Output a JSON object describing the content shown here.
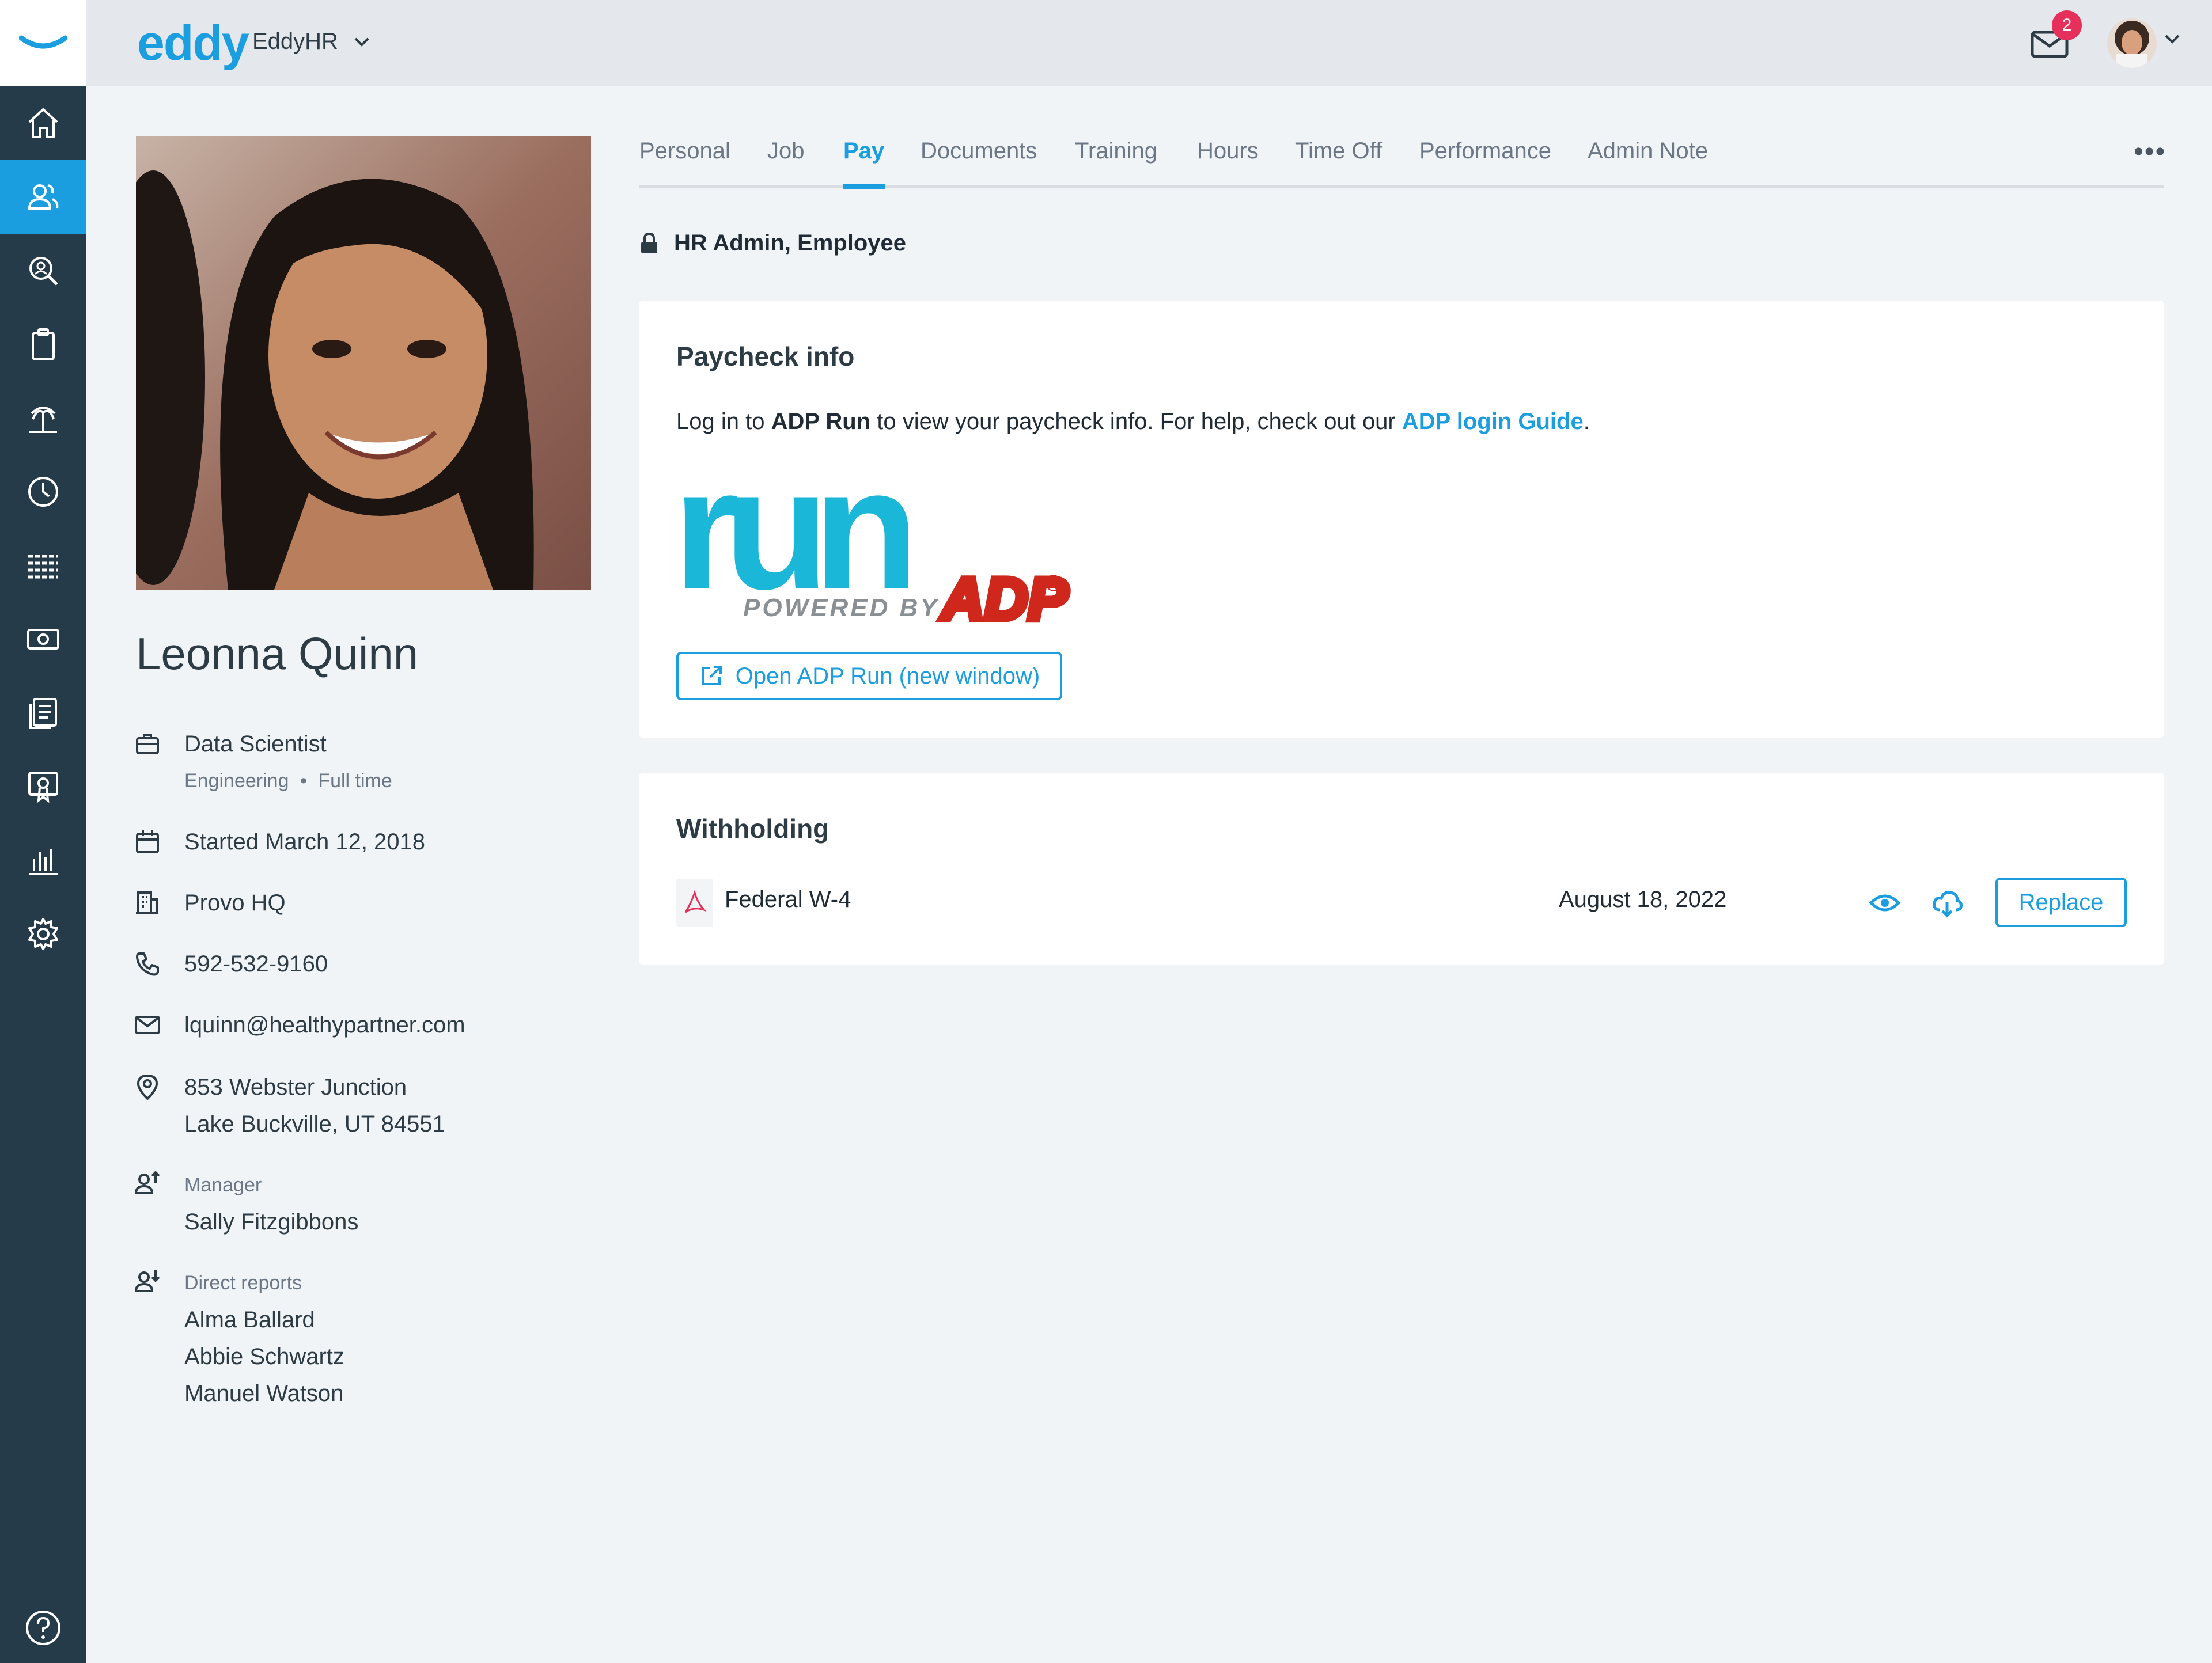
{
  "header": {
    "brand": "eddy",
    "company": "EddyHR",
    "notification_count": "2"
  },
  "sidebar": {
    "items": [
      {
        "icon": "home-icon"
      },
      {
        "icon": "people-icon",
        "active": true
      },
      {
        "icon": "search-person-icon"
      },
      {
        "icon": "clipboard-icon"
      },
      {
        "icon": "palm-tree-icon"
      },
      {
        "icon": "clock-icon"
      },
      {
        "icon": "table-grid-icon"
      },
      {
        "icon": "money-icon"
      },
      {
        "icon": "documents-icon"
      },
      {
        "icon": "certificate-icon"
      },
      {
        "icon": "bar-chart-icon"
      },
      {
        "icon": "gear-icon"
      }
    ],
    "help_icon": "help-icon"
  },
  "profile": {
    "name": "Leonna Quinn",
    "title": "Data Scientist",
    "department": "Engineering",
    "employment_type": "Full time",
    "start": "Started March 12, 2018",
    "location": "Provo HQ",
    "phone": "592-532-9160",
    "email": "lquinn@healthypartner.com",
    "address_line1": "853 Webster Junction",
    "address_line2": "Lake Buckville, UT 84551",
    "manager_label": "Manager",
    "manager": "Sally Fitzgibbons",
    "reports_label": "Direct reports",
    "reports": [
      "Alma Ballard",
      "Abbie Schwartz",
      "Manuel Watson"
    ]
  },
  "tabs": [
    {
      "label": "Personal"
    },
    {
      "label": "Job"
    },
    {
      "label": "Pay",
      "active": true
    },
    {
      "label": "Documents"
    },
    {
      "label": "Training"
    },
    {
      "label": "Hours"
    },
    {
      "label": "Time Off"
    },
    {
      "label": "Performance"
    },
    {
      "label": "Admin Note"
    }
  ],
  "access": "HR Admin, Employee",
  "paycheck": {
    "title": "Paycheck info",
    "text_1": "Log in to ",
    "adp_run": "ADP Run",
    "text_2": " to view your paycheck info. For help, check out our ",
    "guide_link": "ADP login Guide",
    "text_3": ".",
    "logo_word": "run",
    "logo_powered": "POWERED BY",
    "logo_brand": "ADP",
    "logo_reg": "®",
    "open_button": "Open ADP Run (new window)"
  },
  "withholding": {
    "title": "Withholding",
    "doc_name": "Federal W-4",
    "doc_date": "August 18, 2022",
    "replace_button": "Replace"
  },
  "colors": {
    "accent": "#1a9ee0",
    "sidebar": "#263b4a",
    "badge": "#e5305c",
    "adp_red": "#d0271d"
  }
}
